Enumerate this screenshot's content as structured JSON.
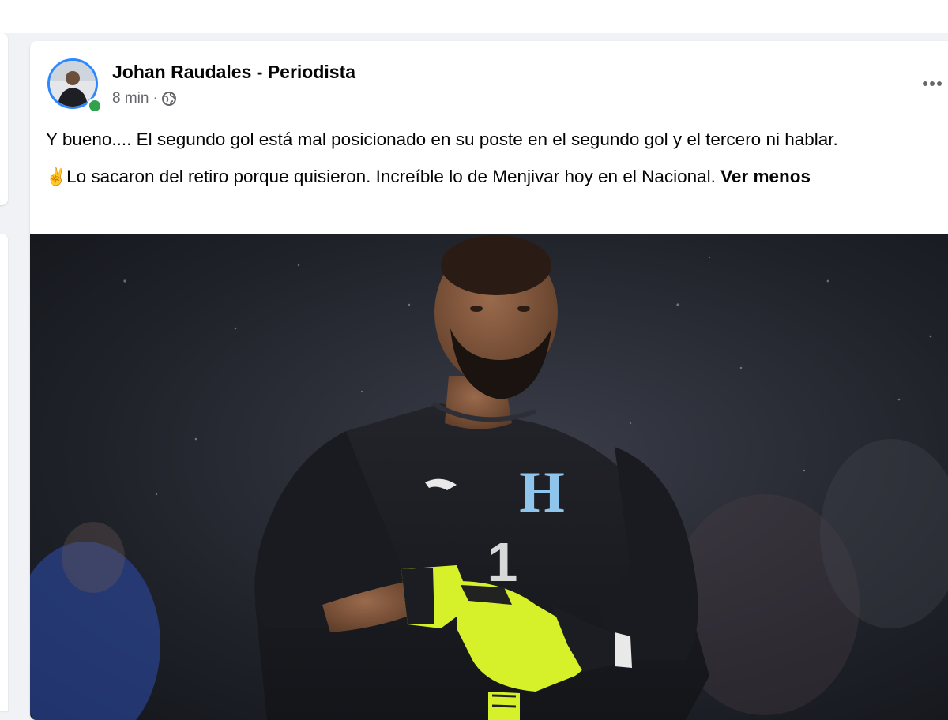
{
  "post": {
    "author": "Johan Raudales - Periodista",
    "time": "8 min",
    "separator": "·",
    "paragraph_1": "Y bueno.... El segundo gol está mal posicionado en su poste en el segundo gol y el tercero ni hablar.",
    "emoji": "✌",
    "paragraph_2": "Lo sacaron del retiro porque quisieron. Increíble lo de Menjivar hoy en el Nacional.",
    "see_less": "Ver menos"
  },
  "icons": {
    "privacy": "globe-icon",
    "options": "more-options-icon",
    "presence": "online-dot"
  },
  "colors": {
    "name_text": "#050505",
    "meta_text": "#65676b",
    "online": "#31a24c",
    "avatar_ring": "#2d88ff",
    "jersey": "#1b1c20",
    "gloves": "#d6f12a"
  },
  "photo": {
    "crest_letter": "H",
    "shirt_number": "1"
  }
}
